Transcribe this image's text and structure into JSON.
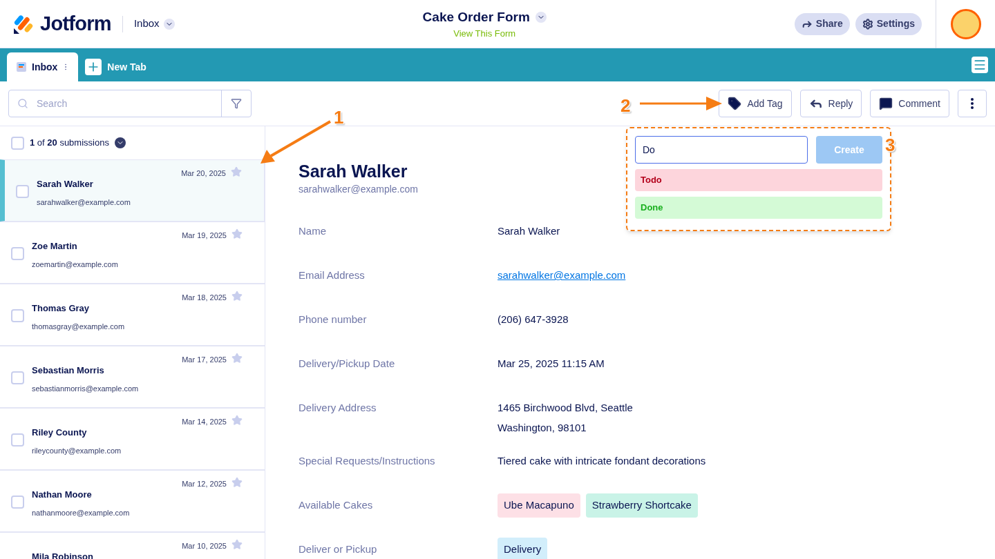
{
  "header": {
    "logo": "Jotform",
    "section": "Inbox",
    "form_title": "Cake Order Form",
    "form_link": "View This Form",
    "buttons": [
      {
        "label": "Share",
        "kind": "share"
      },
      {
        "label": "Settings",
        "kind": "settings"
      }
    ]
  },
  "tabs": [
    {
      "label": "Inbox",
      "selected": true
    }
  ],
  "new_tab": "New Tab",
  "search": {
    "placeholder": "Search"
  },
  "actions": [
    {
      "label": "Add Tag",
      "kind": "tag"
    },
    {
      "label": "Reply",
      "kind": "reply"
    },
    {
      "label": "Comment",
      "kind": "comment"
    }
  ],
  "list": {
    "count": "**1** of **20** submissions",
    "checked": false
  },
  "submissions": [
    {
      "name": "Sarah Walker",
      "email": "sarahwalker@example.com",
      "date": "Mar 20, 2025",
      "selected": true,
      "checked": false
    },
    {
      "name": "Zoe Martin",
      "email": "zoemartin@example.com",
      "date": "Mar 19, 2025",
      "selected": false,
      "checked": false
    },
    {
      "name": "Thomas Gray",
      "email": "thomasgray@example.com",
      "date": "Mar 18, 2025",
      "selected": false,
      "checked": false
    },
    {
      "name": "Sebastian Morris",
      "email": "sebastianmorris@example.com",
      "date": "Mar 17, 2025",
      "selected": false,
      "checked": false
    },
    {
      "name": "Riley County",
      "email": "rileycounty@example.com",
      "date": "Mar 14, 2025",
      "selected": false,
      "checked": false
    },
    {
      "name": "Nathan Moore",
      "email": "nathanmoore@example.com",
      "date": "Mar 12, 2025",
      "selected": false,
      "checked": false
    },
    {
      "name": "Mila Robinson",
      "date": "Mar 10, 2025",
      "selected": false
    }
  ],
  "tag_popup": {
    "value": "Do",
    "button": "Create",
    "tags": [
      {
        "label": "Todo",
        "color": "#fdd5dc"
      },
      {
        "label": "Done",
        "color": "#d4fad6"
      }
    ]
  },
  "detail": {
    "name": "Sarah Walker",
    "email": "sarahwalker@example.com",
    "fields": [
      {
        "label": "Name",
        "kind": "text",
        "lines": [
          "Sarah Walker"
        ]
      },
      {
        "label": "Email Address",
        "kind": "link",
        "lines": [
          "sarahwalker@example.com"
        ]
      },
      {
        "label": "Phone number",
        "kind": "text",
        "lines": [
          "(206) 647-3928"
        ]
      },
      {
        "label": "Delivery/Pickup Date",
        "kind": "text",
        "lines": [
          "Mar 25, 2025 11:15 AM"
        ]
      },
      {
        "label": "Delivery Address",
        "kind": "text",
        "lines": [
          "1465 Birchwood Blvd, Seattle",
          "Washington, 98101"
        ]
      },
      {
        "label": "Special Requests/Instructions",
        "kind": "text",
        "lines": [
          "Tiered cake with intricate fondant decorations"
        ]
      },
      {
        "label": "Available Cakes",
        "kind": "tags",
        "tags": [
          {
            "label": "Ube Macapuno",
            "color": "#fde0e6"
          },
          {
            "label": "Strawberry Shortcake",
            "color": "#c9f3e7"
          }
        ]
      },
      {
        "label": "Deliver or Pickup",
        "kind": "tags",
        "tags": [
          {
            "label": "Delivery",
            "color": "#d2eefb"
          }
        ]
      }
    ]
  },
  "annotations": [
    {
      "label": "1",
      "kind": "list"
    },
    {
      "label": "2",
      "kind": "tag"
    },
    {
      "label": "3",
      "kind": "popup"
    }
  ]
}
